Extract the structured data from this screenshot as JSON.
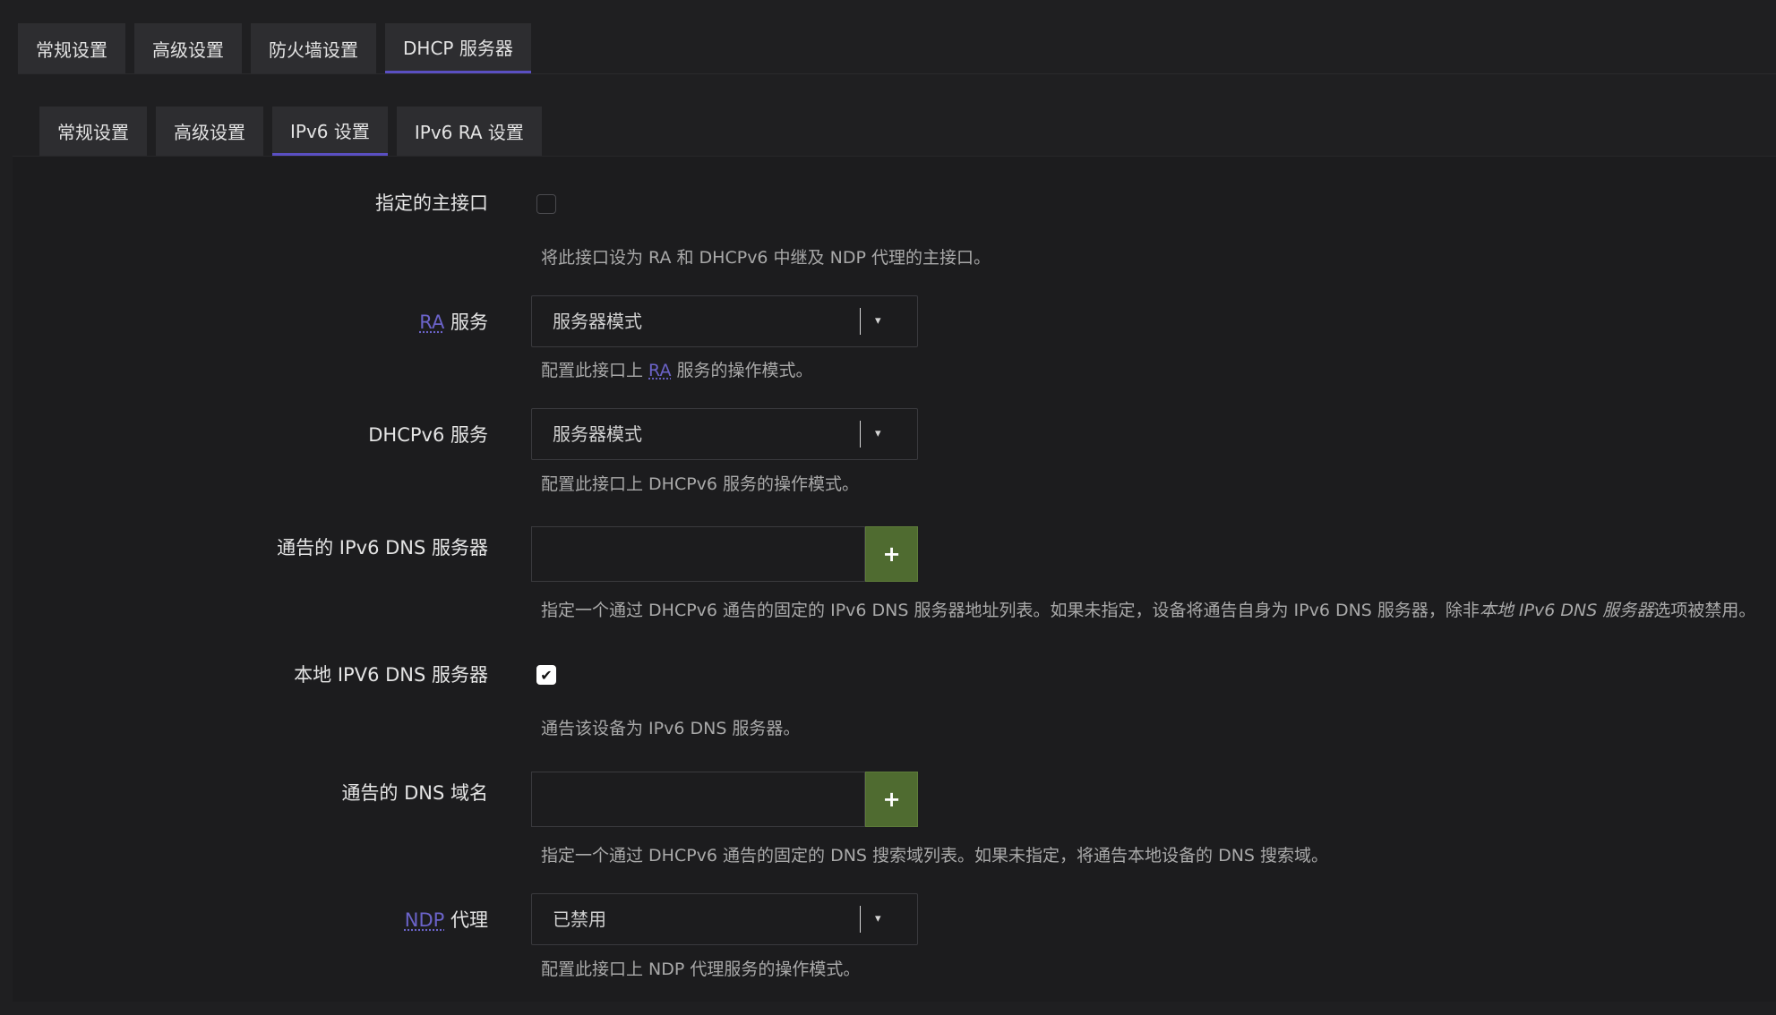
{
  "top_tabs": [
    {
      "label": "常规设置"
    },
    {
      "label": "高级设置"
    },
    {
      "label": "防火墙设置"
    },
    {
      "label": "DHCP 服务器",
      "active": true
    }
  ],
  "sub_tabs": [
    {
      "label": "常规设置"
    },
    {
      "label": "高级设置"
    },
    {
      "label": "IPv6 设置",
      "active": true
    },
    {
      "label": "IPv6 RA 设置"
    }
  ],
  "fields": {
    "master_interface": {
      "label": "指定的主接口",
      "checked": false,
      "description": "将此接口设为 RA 和 DHCPv6 中继及 NDP 代理的主接口。"
    },
    "ra_service": {
      "label_abbr": "RA",
      "label_rest": " 服务",
      "value": "服务器模式",
      "desc_before": "配置此接口上 ",
      "desc_abbr": "RA",
      "desc_after": " 服务的操作模式。"
    },
    "dhcpv6_service": {
      "label": "DHCPv6 服务",
      "value": "服务器模式",
      "description": "配置此接口上 DHCPv6 服务的操作模式。"
    },
    "announced_dns": {
      "label": "通告的 IPv6 DNS 服务器",
      "value": "",
      "add_label": "+",
      "desc_before": "指定一个通过 DHCPv6 通告的固定的 IPv6 DNS 服务器地址列表。如果未指定，设备将通告自身为 IPv6 DNS 服务器，除非",
      "desc_em": "本地 IPv6 DNS 服务器",
      "desc_after": "选项被禁用。"
    },
    "local_dns": {
      "label": "本地 IPV6 DNS 服务器",
      "checked": true,
      "check_glyph": "✔",
      "description": "通告该设备为 IPv6 DNS 服务器。"
    },
    "announced_domains": {
      "label": "通告的 DNS 域名",
      "value": "",
      "add_label": "+",
      "description": "指定一个通过 DHCPv6 通告的固定的 DNS 搜索域列表。如果未指定，将通告本地设备的 DNS 搜索域。"
    },
    "ndp_proxy": {
      "label_abbr": "NDP",
      "label_rest": " 代理",
      "value": "已禁用",
      "description": "配置此接口上 NDP 代理服务的操作模式。"
    }
  },
  "colors": {
    "background": "#1f1f21",
    "accent": "#5a4fc2",
    "add_button": "#4f6b30",
    "abbr_link": "#6b63c9"
  },
  "icons": {
    "dropdown": "▾"
  }
}
